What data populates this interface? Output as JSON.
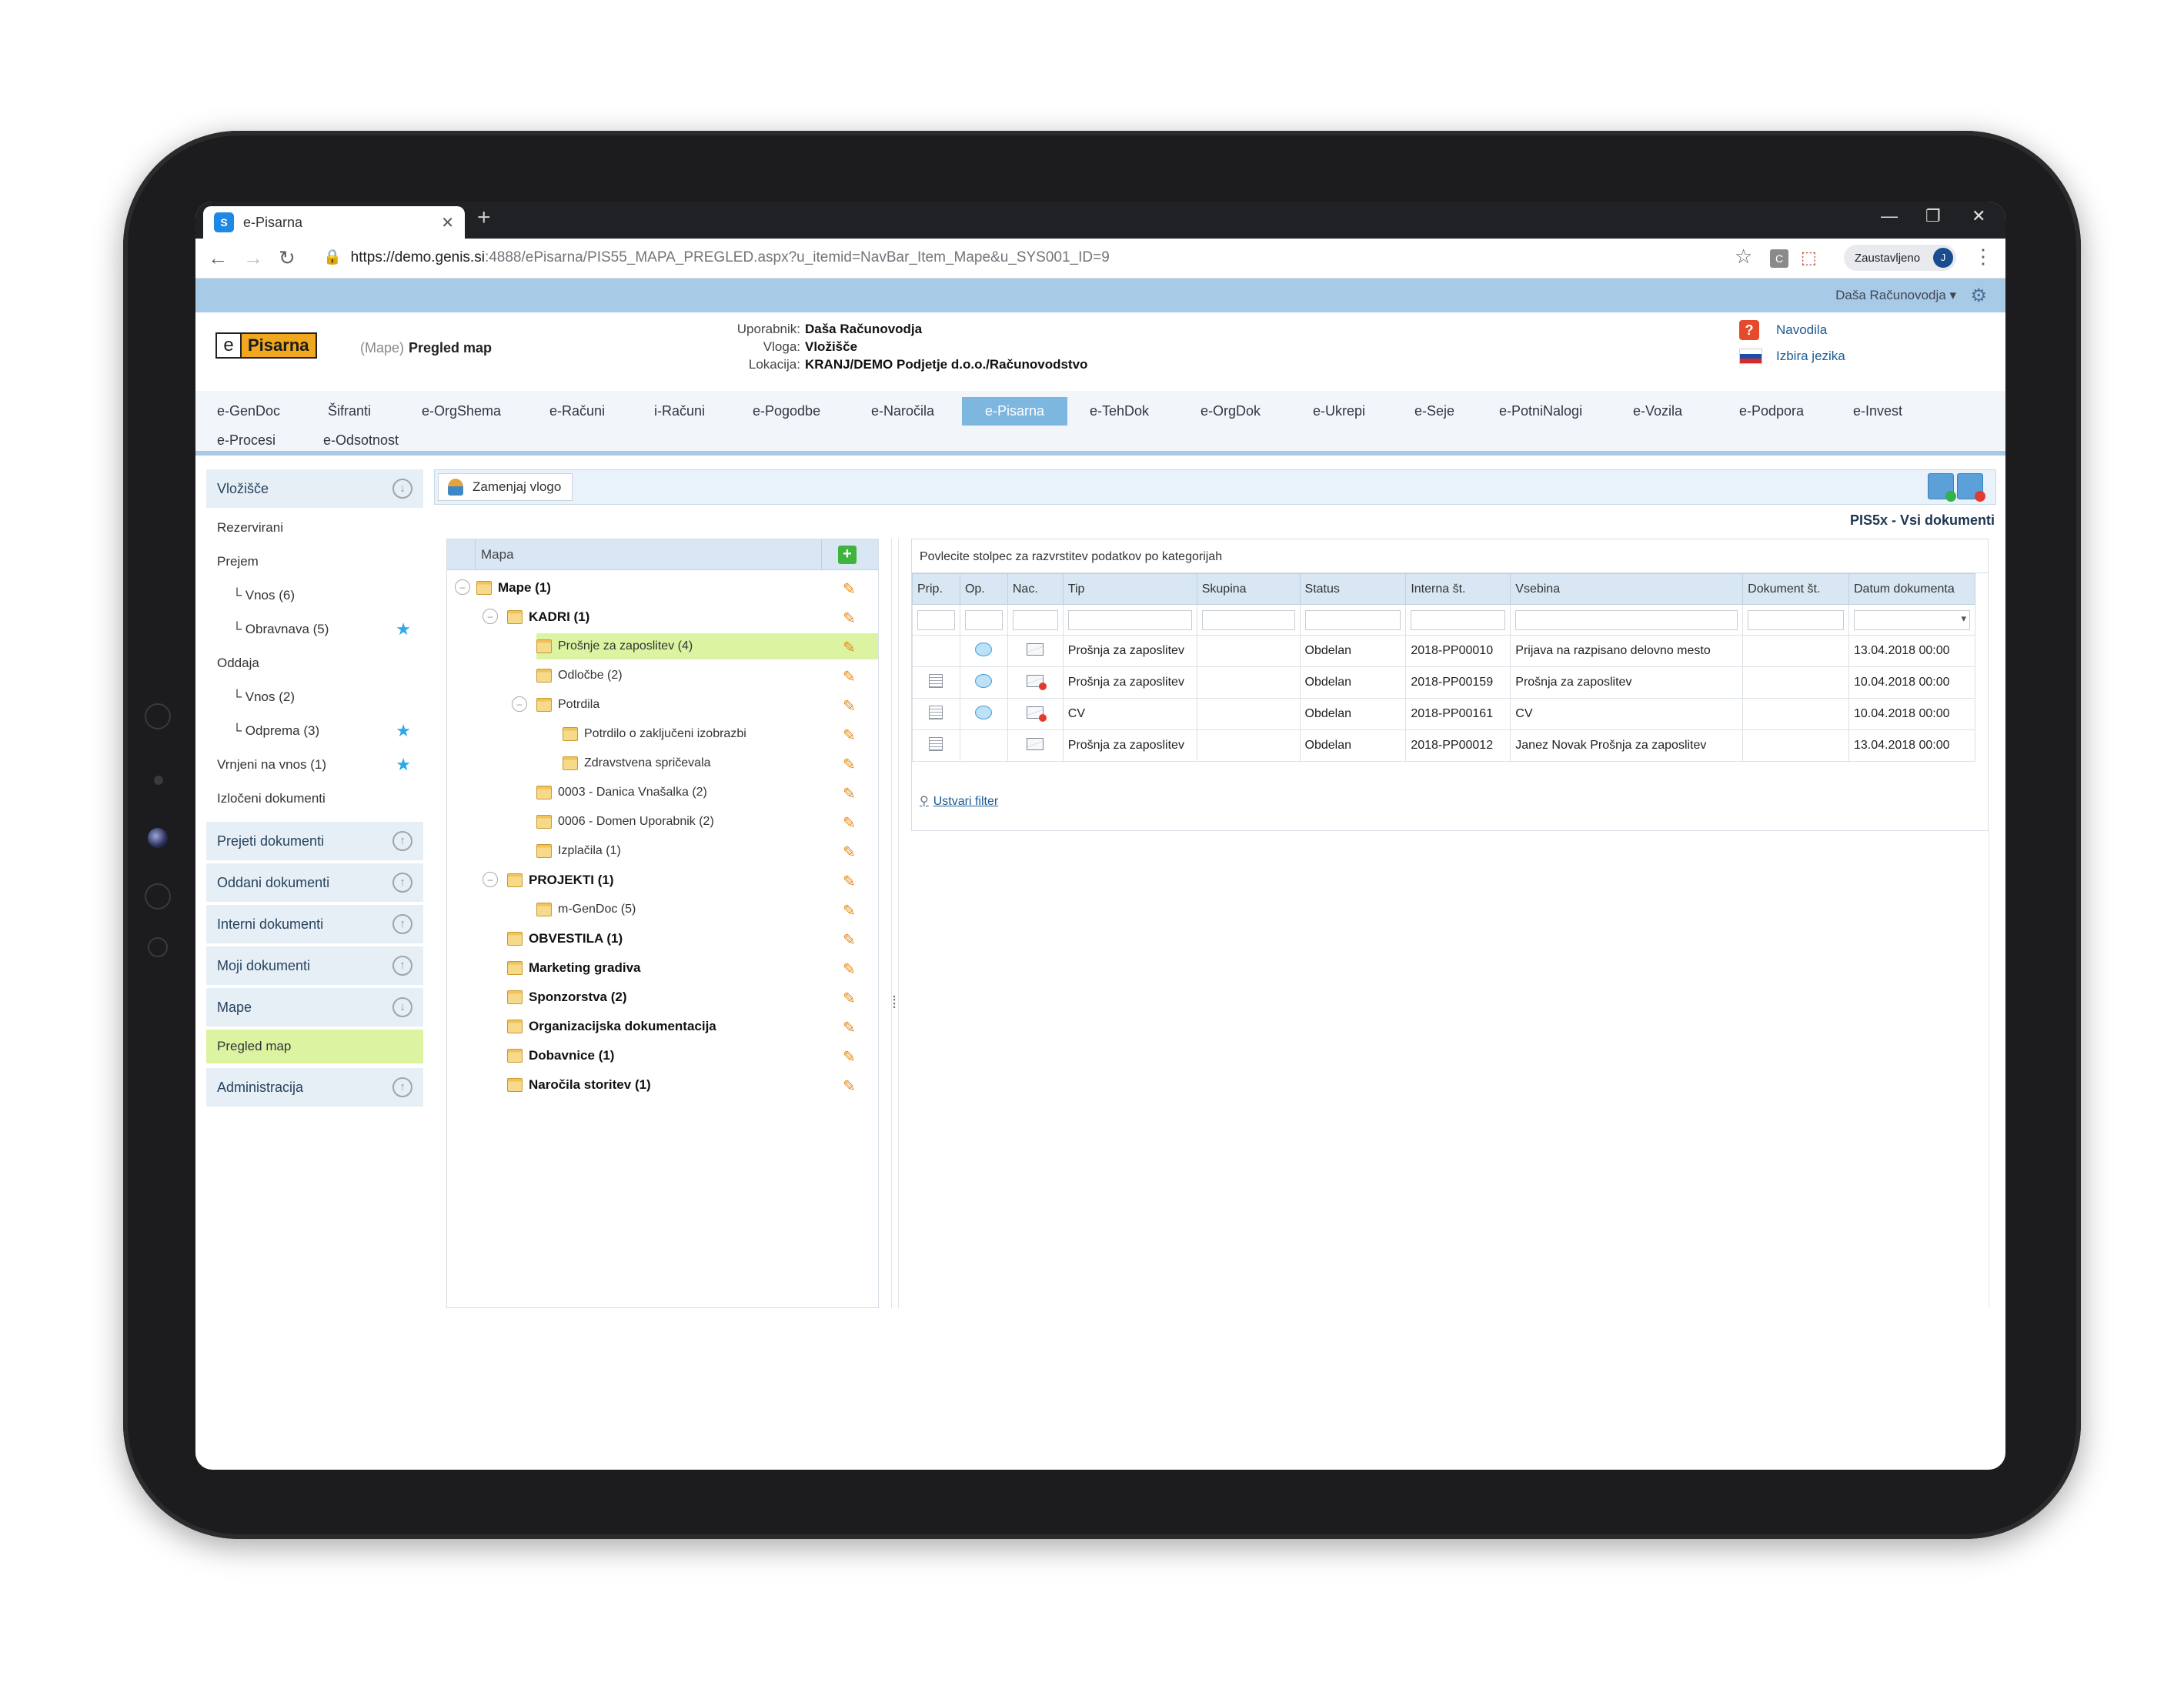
{
  "browser": {
    "tab_title": "e-Pisarna",
    "tab_favicon": "S",
    "url_host": "https://demo.genis.si",
    "url_rest": ":4888/ePisarna/PIS55_MAPA_PREGLED.aspx?u_itemid=NavBar_Item_Mape&u_SYS001_ID=9",
    "profile_label": "Zaustavljeno",
    "profile_initial": "J",
    "ext_c": "C"
  },
  "app": {
    "user_menu": "Daša Računovodja ▾",
    "logo_e": "e",
    "logo_name": "Pisarna",
    "breadcrumb_prefix": "(Mape)",
    "breadcrumb_title": "Pregled map",
    "user_label": "Uporabnik:",
    "user_value": "Daša Računovodja",
    "role_label": "Vloga:",
    "role_value": "Vložišče",
    "location_label": "Lokacija:",
    "location_value": "KRANJ/DEMO Podjetje d.o.o./Računovodstvo",
    "help_link": "Navodila",
    "language_link": "Izbira jezika",
    "help_icon": "?",
    "accent_color": "#7db6de"
  },
  "nav": {
    "row1": [
      "e-GenDoc",
      "Šifranti",
      "e-OrgShema",
      "e-Računi",
      "i-Računi",
      "e-Pogodbe",
      "e-Naročila",
      "e-Pisarna",
      "e-TehDok",
      "e-OrgDok",
      "e-Ukrepi",
      "e-Seje",
      "e-PotniNalogi",
      "e-Vozila",
      "e-Podpora",
      "e-Invest"
    ],
    "row2": [
      "e-Procesi",
      "e-Odsotnost"
    ],
    "active": "e-Pisarna"
  },
  "sidebar": {
    "vlozisce": "Vložišče",
    "rezervirani": "Rezervirani",
    "prejem": "Prejem",
    "prejem_vnos": "└ Vnos (6)",
    "prejem_obravnava": "└ Obravnava (5)",
    "oddaja": "Oddaja",
    "oddaja_vnos": "└ Vnos (2)",
    "oddaja_odprema": "└ Odprema (3)",
    "vrnjeni": "Vrnjeni na vnos (1)",
    "izloceni": "Izločeni dokumenti",
    "prejeti": "Prejeti dokumenti",
    "oddani": "Oddani dokumenti",
    "interni": "Interni dokumenti",
    "moji": "Moji dokumenti",
    "mape": "Mape",
    "pregled_map": "Pregled map",
    "administracija": "Administracija",
    "star": "★",
    "arrow_down": "↓",
    "arrow_up": "↑"
  },
  "toolbar": {
    "replace_role": "Zamenjaj vlogo",
    "page_title": "PIS5x - Vsi dokumenti"
  },
  "tree": {
    "header": "Mapa",
    "plus": "+",
    "pencil": "✎",
    "collapse": "–",
    "nodes": {
      "mape": "Mape (1)",
      "kadri": "KADRI (1)",
      "prosnje": "Prošnje za zaposlitev (4)",
      "odlocbe": "Odločbe (2)",
      "potrdila": "Potrdila",
      "potrdilo_izobrazbi": "Potrdilo o zaključeni izobrazbi",
      "zdravstvena": "Zdravstvena spričevala",
      "danica": "0003 - Danica Vnašalka (2)",
      "domen": "0006 - Domen Uporabnik (2)",
      "izplacila": "Izplačila (1)",
      "projekti": "PROJEKTI (1)",
      "mgendoc": "m-GenDoc (5)",
      "obvestila": "OBVESTILA (1)",
      "marketing": "Marketing gradiva",
      "sponzorstva": "Sponzorstva (2)",
      "organizacijska": "Organizacijska dokumentacija",
      "dobavnice": "Dobavnice (1)",
      "narocila": "Naročila storitev (1)"
    }
  },
  "grid": {
    "group_hint": "Povlecite stolpec za razvrstitev podatkov po kategorijah",
    "columns": [
      "Prip.",
      "Op.",
      "Nac.",
      "Tip",
      "Skupina",
      "Status",
      "Interna št.",
      "Vsebina",
      "Dokument št.",
      "Datum dokumenta"
    ],
    "rows": [
      {
        "tip": "Prošnja za zaposlitev",
        "skupina": "",
        "status": "Obdelan",
        "interna": "2018-PP00010",
        "vsebina": "Prijava na razpisano delovno mesto",
        "dokument": "",
        "datum": "13.04.2018 00:00"
      },
      {
        "tip": "Prošnja za zaposlitev",
        "skupina": "",
        "status": "Obdelan",
        "interna": "2018-PP00159",
        "vsebina": "Prošnja za zaposlitev",
        "dokument": "",
        "datum": "10.04.2018 00:00"
      },
      {
        "tip": "CV",
        "skupina": "",
        "status": "Obdelan",
        "interna": "2018-PP00161",
        "vsebina": "CV",
        "dokument": "",
        "datum": "10.04.2018 00:00"
      },
      {
        "tip": "Prošnja za zaposlitev",
        "skupina": "",
        "status": "Obdelan",
        "interna": "2018-PP00012",
        "vsebina": "Janez Novak Prošnja za zaposlitev",
        "dokument": "",
        "datum": "13.04.2018 00:00"
      }
    ],
    "filter_link": "Ustvari filter"
  }
}
